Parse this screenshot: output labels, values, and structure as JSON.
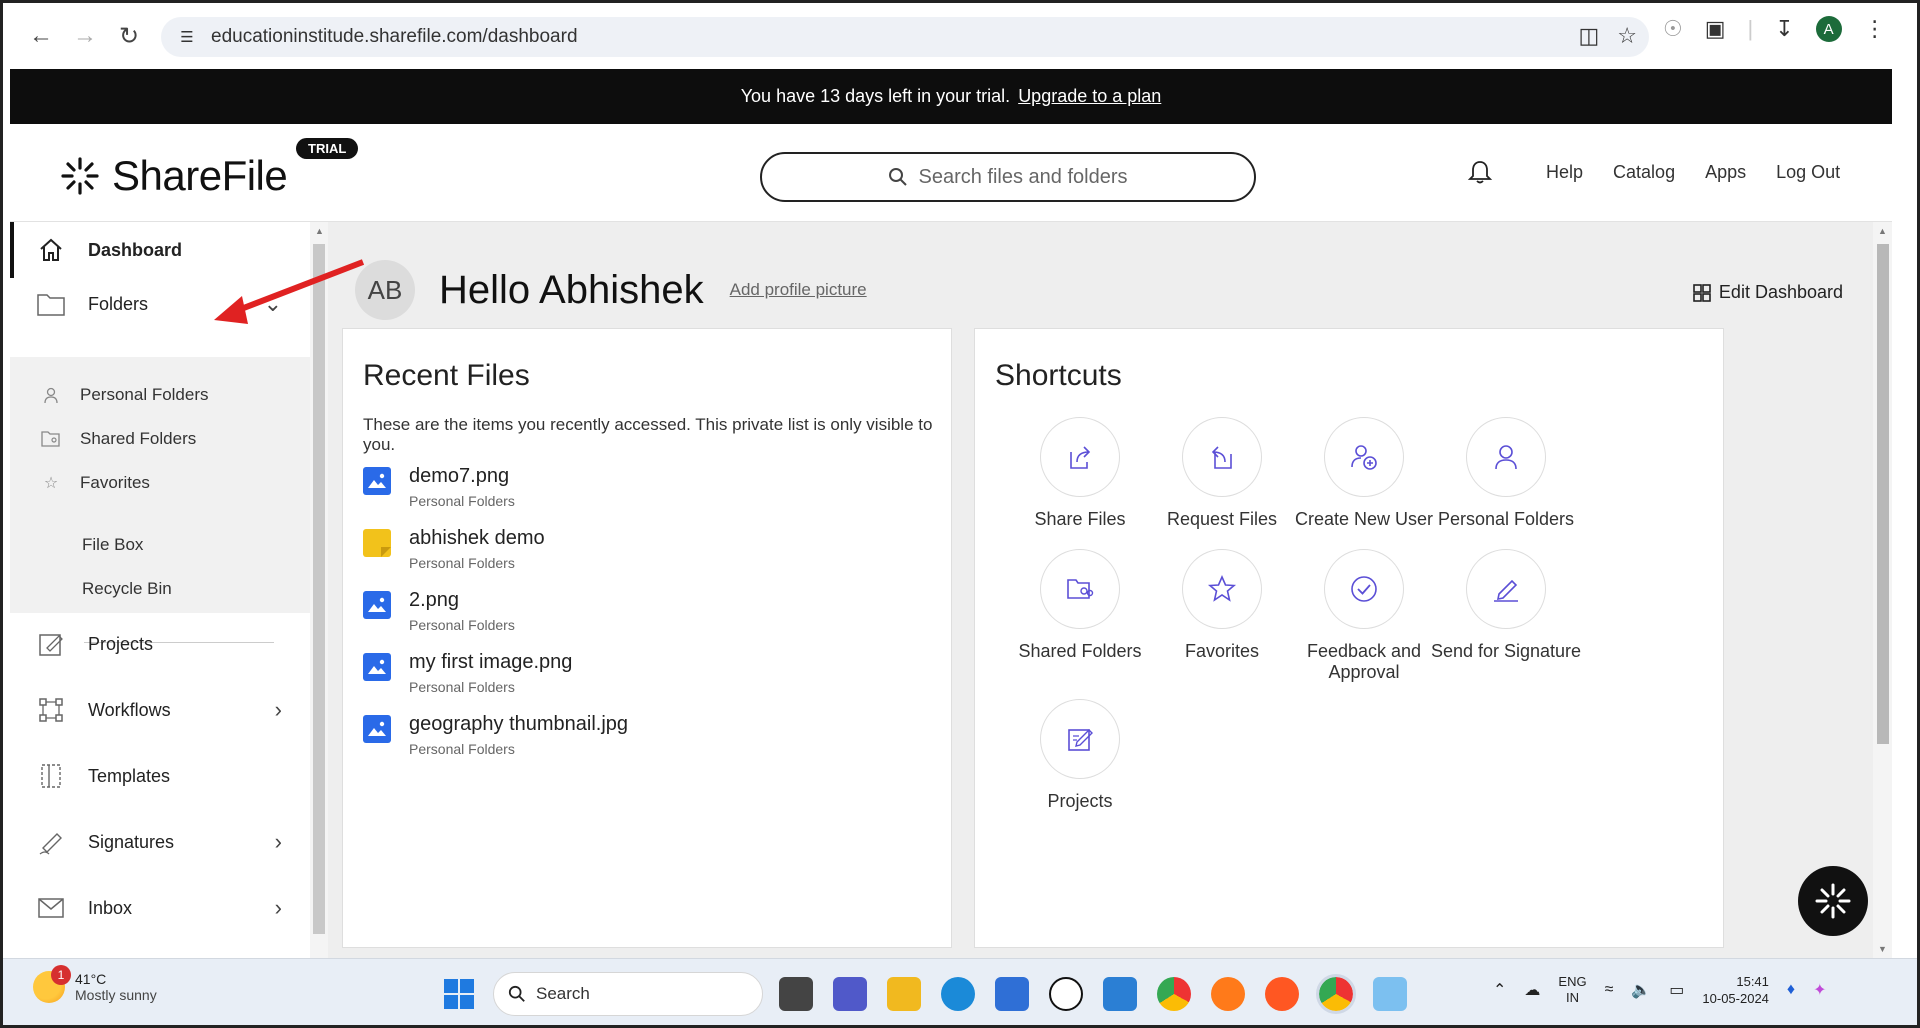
{
  "browser": {
    "url": "educationinstitude.sharefile.com/dashboard",
    "profile_initial": "A"
  },
  "banner": {
    "message": "You have 13 days left in your trial.",
    "link": "Upgrade to a plan"
  },
  "header": {
    "logo_text": "ShareFile",
    "trial_badge": "TRIAL",
    "search_placeholder": "Search files and folders",
    "nav": [
      "Help",
      "Catalog",
      "Apps",
      "Log Out"
    ]
  },
  "sidebar": {
    "items": [
      {
        "label": "Dashboard",
        "icon": "home-icon",
        "active": true
      },
      {
        "label": "Folders",
        "icon": "folder-icon",
        "chevron": "down"
      },
      {
        "label": "Projects",
        "icon": "projects-icon"
      },
      {
        "label": "Workflows",
        "icon": "workflows-icon",
        "chevron": "right"
      },
      {
        "label": "Templates",
        "icon": "templates-icon"
      },
      {
        "label": "Signatures",
        "icon": "signature-icon",
        "chevron": "right"
      },
      {
        "label": "Inbox",
        "icon": "inbox-icon",
        "chevron": "right"
      }
    ],
    "folders_sub": [
      {
        "label": "Personal Folders",
        "icon": "person-icon"
      },
      {
        "label": "Shared Folders",
        "icon": "shared-folder-icon"
      },
      {
        "label": "Favorites",
        "icon": "star-icon"
      },
      {
        "label": "File Box"
      },
      {
        "label": "Recycle Bin"
      }
    ]
  },
  "main": {
    "avatar_initials": "AB",
    "greeting": "Hello Abhishek",
    "add_picture": "Add profile picture",
    "edit_dashboard": "Edit Dashboard",
    "recent": {
      "title": "Recent Files",
      "subtitle": "These are the items you recently accessed. This private list is only visible to you.",
      "files": [
        {
          "name": "demo7.png",
          "location": "Personal Folders",
          "type": "image"
        },
        {
          "name": "abhishek demo",
          "location": "Personal Folders",
          "type": "note"
        },
        {
          "name": "2.png",
          "location": "Personal Folders",
          "type": "image"
        },
        {
          "name": "my first image.png",
          "location": "Personal Folders",
          "type": "image"
        },
        {
          "name": "geography thumbnail.jpg",
          "location": "Personal Folders",
          "type": "image"
        }
      ]
    },
    "shortcuts": {
      "title": "Shortcuts",
      "items": [
        {
          "label": "Share Files",
          "icon": "share-icon"
        },
        {
          "label": "Request Files",
          "icon": "request-icon"
        },
        {
          "label": "Create New User",
          "icon": "add-user-icon"
        },
        {
          "label": "Personal Folders",
          "icon": "person-icon"
        },
        {
          "label": "Shared Folders",
          "icon": "shared-folder-icon"
        },
        {
          "label": "Favorites",
          "icon": "star-icon"
        },
        {
          "label": "Feedback and Approval",
          "icon": "check-circle-icon"
        },
        {
          "label": "Send for Signature",
          "icon": "pen-icon"
        },
        {
          "label": "Projects",
          "icon": "projects-icon"
        }
      ]
    }
  },
  "taskbar": {
    "weather_temp": "41°C",
    "weather_desc": "Mostly sunny",
    "weather_badge": "1",
    "search_label": "Search",
    "lang_line1": "ENG",
    "lang_line2": "IN",
    "time": "15:41",
    "date": "10-05-2024"
  },
  "colors": {
    "accent_icon": "#5b4fd6",
    "banner_bg": "#0d0d0d",
    "file_image": "#2a6ae8",
    "file_note": "#f2c21b"
  }
}
